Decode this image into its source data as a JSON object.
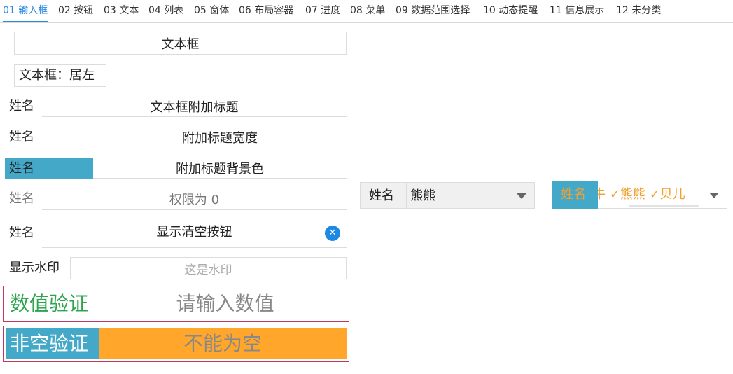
{
  "tabs": [
    {
      "label": "01 输入框",
      "active": true
    },
    {
      "label": "02 按钮"
    },
    {
      "label": "03 文本"
    },
    {
      "label": "04 列表"
    },
    {
      "label": "05 窗体"
    },
    {
      "label": "06 布局容器"
    },
    {
      "label": "07 进度"
    },
    {
      "label": "08 菜单"
    },
    {
      "label": "09 数据范围选择"
    },
    {
      "label": "10 动态提醒"
    },
    {
      "label": "11 信息展示"
    },
    {
      "label": "12 未分类"
    }
  ],
  "fields": {
    "textbox": {
      "value": "文本框"
    },
    "textbox_left": {
      "value": "文本框：居左"
    },
    "title_field": {
      "label": "姓名",
      "value": "文本框附加标题"
    },
    "title_width_field": {
      "label": "姓名",
      "value": "附加标题宽度"
    },
    "title_bg_field": {
      "label": "姓名",
      "value": "附加标题背景色"
    },
    "permission_field": {
      "label": "姓名",
      "value": "权限为 0"
    },
    "clear_field": {
      "label": "姓名",
      "value": "显示清空按钮",
      "clear_glyph": "✕"
    },
    "watermark_field": {
      "label": "显示水印",
      "placeholder": "这是水印"
    },
    "numeric_field": {
      "label": "数值验证",
      "placeholder": "请输入数值"
    },
    "nonempty_field": {
      "label": "非空验证",
      "placeholder": "不能为空"
    }
  },
  "combos": {
    "single": {
      "label": "姓名",
      "value": "熊熊"
    },
    "multi": {
      "label": "姓名",
      "partial": "牛",
      "items": [
        "熊熊",
        "贝儿"
      ],
      "check": "✓"
    }
  },
  "colors": {
    "accent_blue": "#2b8ae3",
    "title_bg": "#44a9c9",
    "clear_button": "#1e88e5",
    "green_label": "#2ea44f",
    "orange_fill": "#ffa62b",
    "orange_text": "#f0a030",
    "invalid_border": "#c0395c"
  }
}
